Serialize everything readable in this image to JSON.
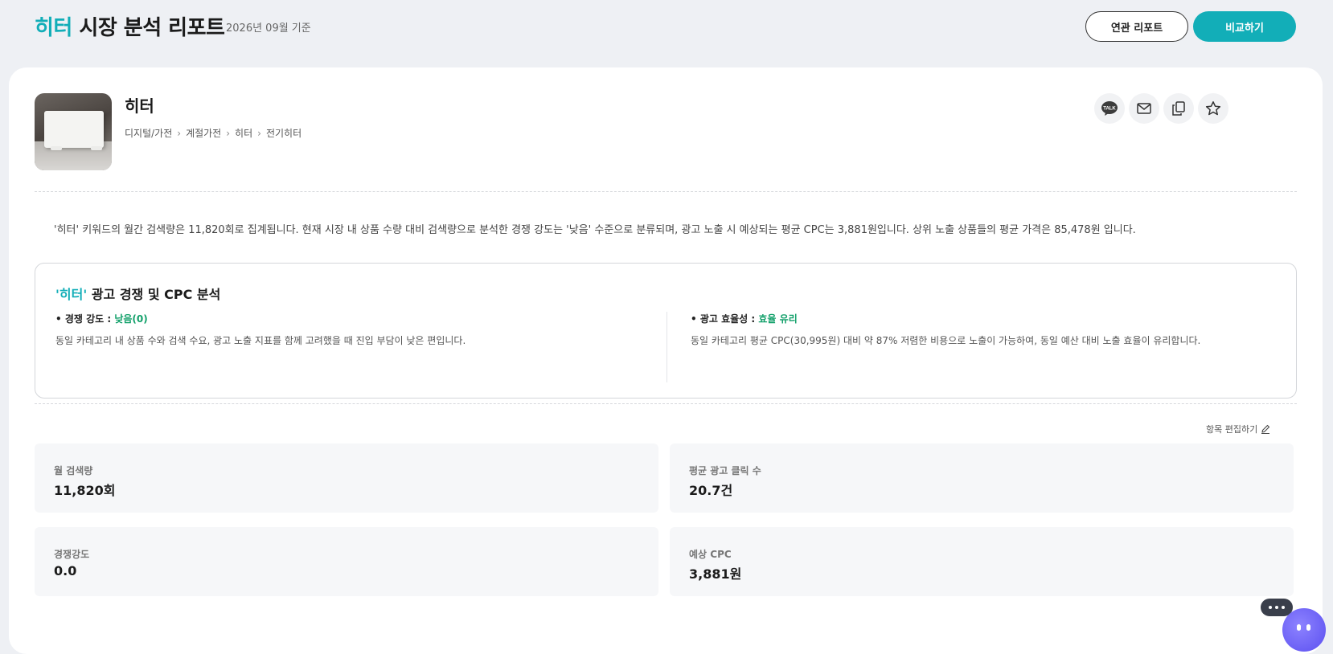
{
  "header": {
    "title_keyword": "히터",
    "title_rest": " 시장 분석 리포트",
    "basis": "2026년 09월 기준",
    "related_button": "연관 리포트",
    "compare_button": "비교하기"
  },
  "product": {
    "name": "히터",
    "breadcrumb": [
      "디지털/가전",
      "계절가전",
      "히터",
      "전기히터"
    ],
    "breadcrumb_sep": "›"
  },
  "share_icons": [
    "kakaotalk-icon",
    "mail-icon",
    "copy-icon",
    "star-icon"
  ],
  "talk_icon_text": "TALK",
  "summary": "'히터' 키워드의 월간 검색량은 11,820회로 집계됩니다. 현재 시장 내 상품 수량 대비 검색량으로 분석한 경쟁 강도는 '낮음' 수준으로 분류되며, 광고 노출 시 예상되는 평균 CPC는 3,881원입니다. 상위 노출 상품들의 평균 가격은 85,478원 입니다.",
  "analysis": {
    "title_keyword": "'히터'",
    "title_rest": " 광고 경쟁 및 CPC 분석",
    "competition": {
      "label": "• 경쟁 강도 : ",
      "value": "낮음(0)",
      "description": "동일 카테고리 내 상품 수와 검색 수요, 광고 노출 지표를 함께 고려했을 때 진입 부담이 낮은 편입니다."
    },
    "efficiency": {
      "label": "• 광고 효율성 : ",
      "value": "효율 유리",
      "description": "동일 카테고리 평균 CPC(30,995원) 대비 약 87% 저렴한 비용으로 노출이 가능하여, 동일 예산 대비 노출 효율이 유리합니다."
    }
  },
  "edit_link": "항목 편집하기",
  "metrics": [
    {
      "label": "월 검색량",
      "value": "11,820회"
    },
    {
      "label": "평균 광고 클릭 수",
      "value": "20.7건"
    },
    {
      "label": "경쟁강도",
      "value": "0.0"
    },
    {
      "label": "예상 CPC",
      "value": "3,881원"
    }
  ],
  "colors": {
    "accent": "#12aeb8",
    "positive": "#12a06a",
    "background": "#eef0f4"
  }
}
